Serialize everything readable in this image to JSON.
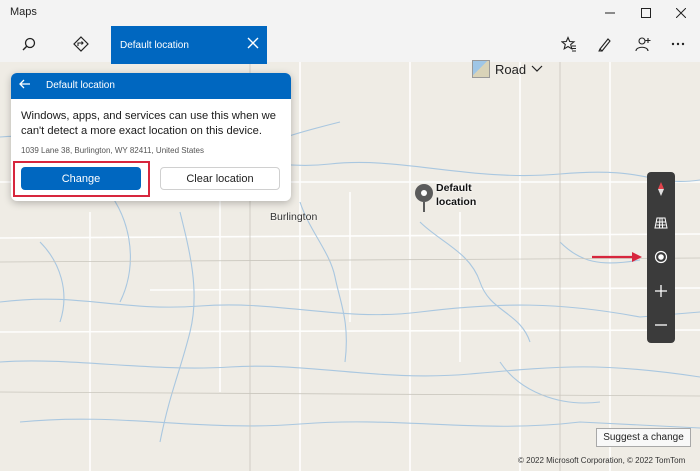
{
  "window": {
    "title": "Maps",
    "controls": [
      "minimize-icon",
      "maximize-icon",
      "close-icon"
    ]
  },
  "toolbar": {
    "search_label": "Default location",
    "view_label": "Road",
    "icons": [
      "search-icon",
      "directions-icon",
      "view-swatch-icon",
      "favorites-icon",
      "ink-icon",
      "add-person-icon",
      "more-icon"
    ]
  },
  "panel": {
    "title": "Default location",
    "description": "Windows, apps, and services can use this when we can't detect a more exact location on this device.",
    "address": "1039 Lane 38, Burlington, WY 82411, United States",
    "change_label": "Change",
    "clear_label": "Clear location"
  },
  "map": {
    "city_label": "Burlington",
    "pin_label_line1": "Default",
    "pin_label_line2": "location",
    "controls": [
      "compass-icon",
      "tilt-icon",
      "locate-icon",
      "zoom-in-icon",
      "zoom-out-icon"
    ],
    "suggest_label": "Suggest a change",
    "copyright": "© 2022 Microsoft Corporation, © 2022 TomTom"
  },
  "colors": {
    "accent": "#0067c0",
    "highlight_red": "#d7263d",
    "map_bg": "#efece5",
    "road": "#ffffff",
    "water": "#a9c7e0"
  }
}
